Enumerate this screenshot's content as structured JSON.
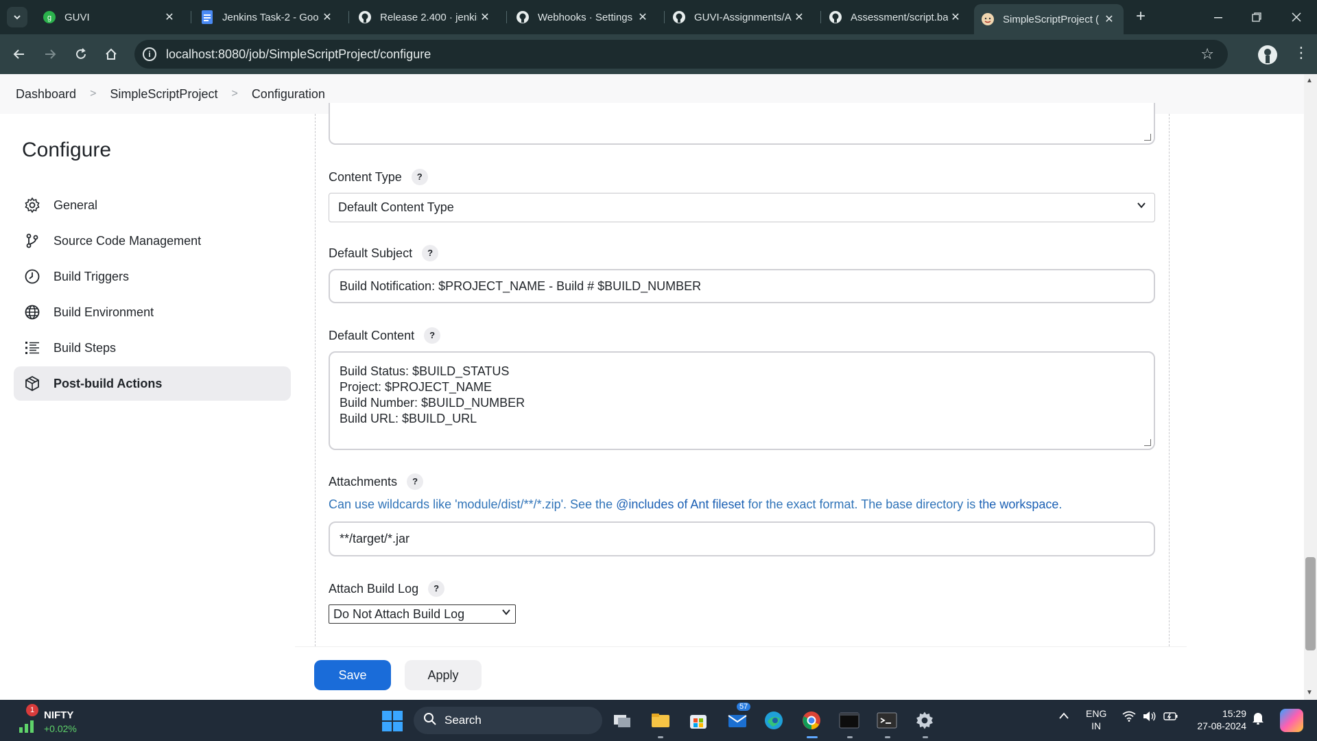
{
  "browser": {
    "tabs": [
      {
        "title": "GUVI",
        "icon": "guvi-icon",
        "active": false
      },
      {
        "title": "Jenkins Task-2 - Goo",
        "icon": "google-docs-icon",
        "active": false
      },
      {
        "title": "Release 2.400 · jenkin",
        "icon": "github-icon",
        "active": false
      },
      {
        "title": "Webhooks · Settings",
        "icon": "github-icon",
        "active": false
      },
      {
        "title": "GUVI-Assignments/A",
        "icon": "github-icon",
        "active": false
      },
      {
        "title": "Assessment/script.ba",
        "icon": "github-icon",
        "active": false
      },
      {
        "title": "SimpleScriptProject (",
        "icon": "jenkins-icon",
        "active": true
      }
    ],
    "url": "localhost:8080/job/SimpleScriptProject/configure"
  },
  "breadcrumb": [
    "Dashboard",
    "SimpleScriptProject",
    "Configuration"
  ],
  "sidebar": {
    "title": "Configure",
    "items": [
      {
        "label": "General",
        "icon": "gear-icon"
      },
      {
        "label": "Source Code Management",
        "icon": "branch-icon"
      },
      {
        "label": "Build Triggers",
        "icon": "clock-icon"
      },
      {
        "label": "Build Environment",
        "icon": "globe-icon"
      },
      {
        "label": "Build Steps",
        "icon": "list-icon"
      },
      {
        "label": "Post-build Actions",
        "icon": "package-icon",
        "active": true
      }
    ]
  },
  "form": {
    "content_type": {
      "label": "Content Type",
      "help": "?",
      "value": "Default Content Type"
    },
    "default_subject": {
      "label": "Default Subject",
      "help": "?",
      "value": "Build Notification: $PROJECT_NAME - Build # $BUILD_NUMBER"
    },
    "default_content": {
      "label": "Default Content",
      "help": "?",
      "lines": [
        "Build Status: $BUILD_STATUS",
        "Project: $PROJECT_NAME",
        "Build Number: $BUILD_NUMBER",
        "Build URL: $BUILD_URL"
      ]
    },
    "attachments": {
      "label": "Attachments",
      "help": "?",
      "hint_prefix": "Can use wildcards like 'module/dist/**/*.zip'. See the ",
      "hint_link1": "@includes of Ant fileset",
      "hint_middle": " for the exact format. The base directory is ",
      "hint_link2": "the workspace",
      "hint_suffix": ".",
      "value": "**/target/*.jar"
    },
    "attach_build_log": {
      "label": "Attach Build Log",
      "help": "?",
      "value": "Do Not Attach Build Log"
    }
  },
  "actions": {
    "save": "Save",
    "apply": "Apply"
  },
  "taskbar": {
    "stock_name": "NIFTY",
    "stock_change": "+0.02%",
    "stock_badge": "1",
    "search_label": "Search",
    "mail_badge": "57",
    "lang_line1": "ENG",
    "lang_line2": "IN",
    "time": "15:29",
    "date": "27-08-2024"
  },
  "colors": {
    "accent": "#1a6cd9",
    "link": "#1a5fb4",
    "tab_bg": "#1c2b2e",
    "toolbar_bg": "#2f4245"
  }
}
